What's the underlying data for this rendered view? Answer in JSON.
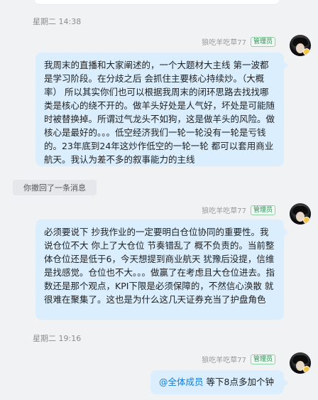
{
  "messages": [
    {
      "type": "timestamp",
      "text": "星期二 14:38"
    },
    {
      "type": "outgoing",
      "sender": "狼吃羊吃草77",
      "badge": "管理员",
      "text": "我周末的直播和大家阐述的，一个大题材大主线 第一波都是学习阶段。在分歧之后 会抓住主要核心持续炒。（大概率） 所以其实你们也可以根据我周末的闭环思路去找找哪类是核心的绕不开的。做羊头好处是人气好，坏处是可能随时被替换掉。所谓过气龙头不如狗，这是做羊头的风险。做核心是最好的。。。低空经济我们一轮一轮没有一轮是亏钱的。23年底到24年这炒作低空的一轮一轮 都可以套用商业航天。我认为差不多的叙事能力的主线"
    },
    {
      "type": "system",
      "text": "你撤回了一条消息"
    },
    {
      "type": "outgoing",
      "sender": "狼吃羊吃草77",
      "badge": "管理员",
      "text": "必须要说下 抄我作业的一定要明白仓位协同的重要性。我说仓位不大 你上了大仓位 节奏错乱了 概不负责的。当前整体仓位还是低于6，今天想提到商业航天 犹豫后没提，信维是找感觉。仓位也不大。。。做赢了在考虑且大仓位进去。指数还是那个观点，KPI下限是必须保障的，不然信心涣散 就很难在聚集了。这也是为什么这几天证券充当了护盘角色"
    },
    {
      "type": "timestamp",
      "text": "星期二 19:16"
    },
    {
      "type": "outgoing",
      "sender": "狼吃羊吃草77",
      "badge": "管理员",
      "mention": "@全体成员",
      "text": " 等下8点多加个钟"
    }
  ],
  "colors": {
    "background": "#f1f2f4",
    "bubble": "#daeefe",
    "mention": "#1a7ad6",
    "badge": "#2e8b57"
  }
}
